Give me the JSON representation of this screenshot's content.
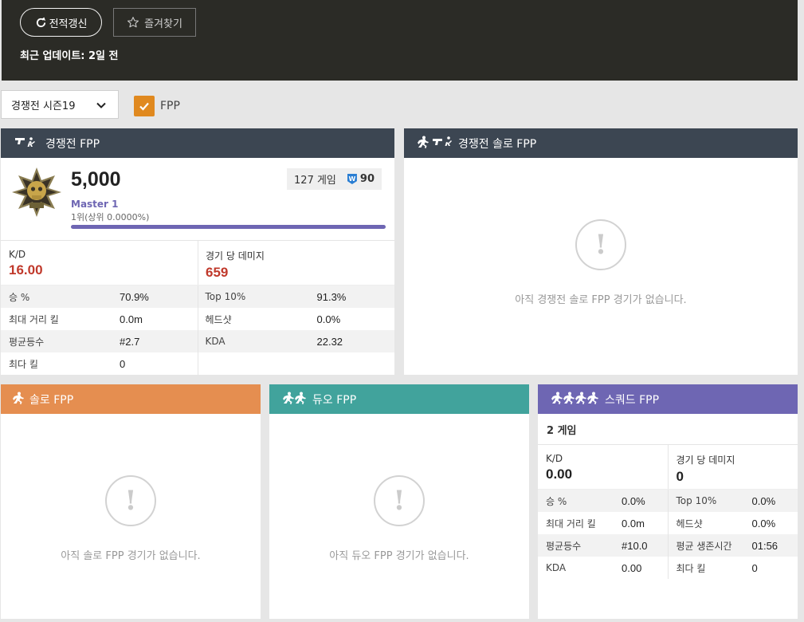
{
  "header": {
    "refresh_label": "전적갱신",
    "favorite_label": "즐겨찾기",
    "update_text": "최근 업데이트: 2일 전"
  },
  "filters": {
    "season": "경쟁전 시즌19",
    "fpp_label": "FPP",
    "fpp_checked": true
  },
  "ranked_fpp": {
    "title": "경쟁전 FPP",
    "rating": "5,000",
    "tier": "Master 1",
    "rank": "1위(상위 0.0000%)",
    "progress_fraction": 1.0,
    "games": "127 게임",
    "wins_badge": "W",
    "wins": "90",
    "kd_label": "K/D",
    "kd_value": "16.00",
    "dmg_label": "경기 당 데미지",
    "dmg_value": "659",
    "stats": [
      {
        "l1": "승 %",
        "v1": "70.9%",
        "l2": "Top 10%",
        "v2": "91.3%"
      },
      {
        "l1": "최대 거리 킬",
        "v1": "0.0m",
        "l2": "헤드샷",
        "v2": "0.0%"
      },
      {
        "l1": "평균등수",
        "v1": "#2.7",
        "l2": "KDA",
        "v2": "22.32"
      },
      {
        "l1": "최다 킬",
        "v1": "0",
        "l2": "",
        "v2": ""
      }
    ]
  },
  "ranked_solo_fpp": {
    "title": "경쟁전 솔로 FPP",
    "empty": "아직 경쟁전 솔로 FPP 경기가 없습니다."
  },
  "solo_fpp": {
    "title": "솔로 FPP",
    "empty": "아직 솔로 FPP 경기가 없습니다."
  },
  "duo_fpp": {
    "title": "듀오 FPP",
    "empty": "아직 듀오 FPP 경기가 없습니다."
  },
  "squad_fpp": {
    "title": "스쿼드 FPP",
    "games": "2 게임",
    "kd_label": "K/D",
    "kd_value": "0.00",
    "dmg_label": "경기 당 데미지",
    "dmg_value": "0",
    "stats": [
      {
        "l1": "승 %",
        "v1": "0.0%",
        "l2": "Top 10%",
        "v2": "0.0%"
      },
      {
        "l1": "최대 거리 킬",
        "v1": "0.0m",
        "l2": "헤드샷",
        "v2": "0.0%"
      },
      {
        "l1": "평균등수",
        "v1": "#10.0",
        "l2": "평균 생존시간",
        "v2": "01:56"
      },
      {
        "l1": "KDA",
        "v1": "0.00",
        "l2": "최다 킬",
        "v2": "0"
      }
    ]
  },
  "colors": {
    "dark_header": "#3c4652",
    "solo_header": "#e58e50",
    "duo_header": "#41a39c",
    "squad_header": "#6e66b3",
    "accent_red": "#c0392b"
  },
  "icons": {
    "refresh": "refresh-icon",
    "favorite": "star-outline-icon",
    "dropdown": "chevron-down-icon",
    "check": "check-icon",
    "gun": "gun-icon",
    "runner": "runner-icon",
    "rank_emblem": "master-emblem-icon",
    "empty": "exclamation-icon"
  }
}
